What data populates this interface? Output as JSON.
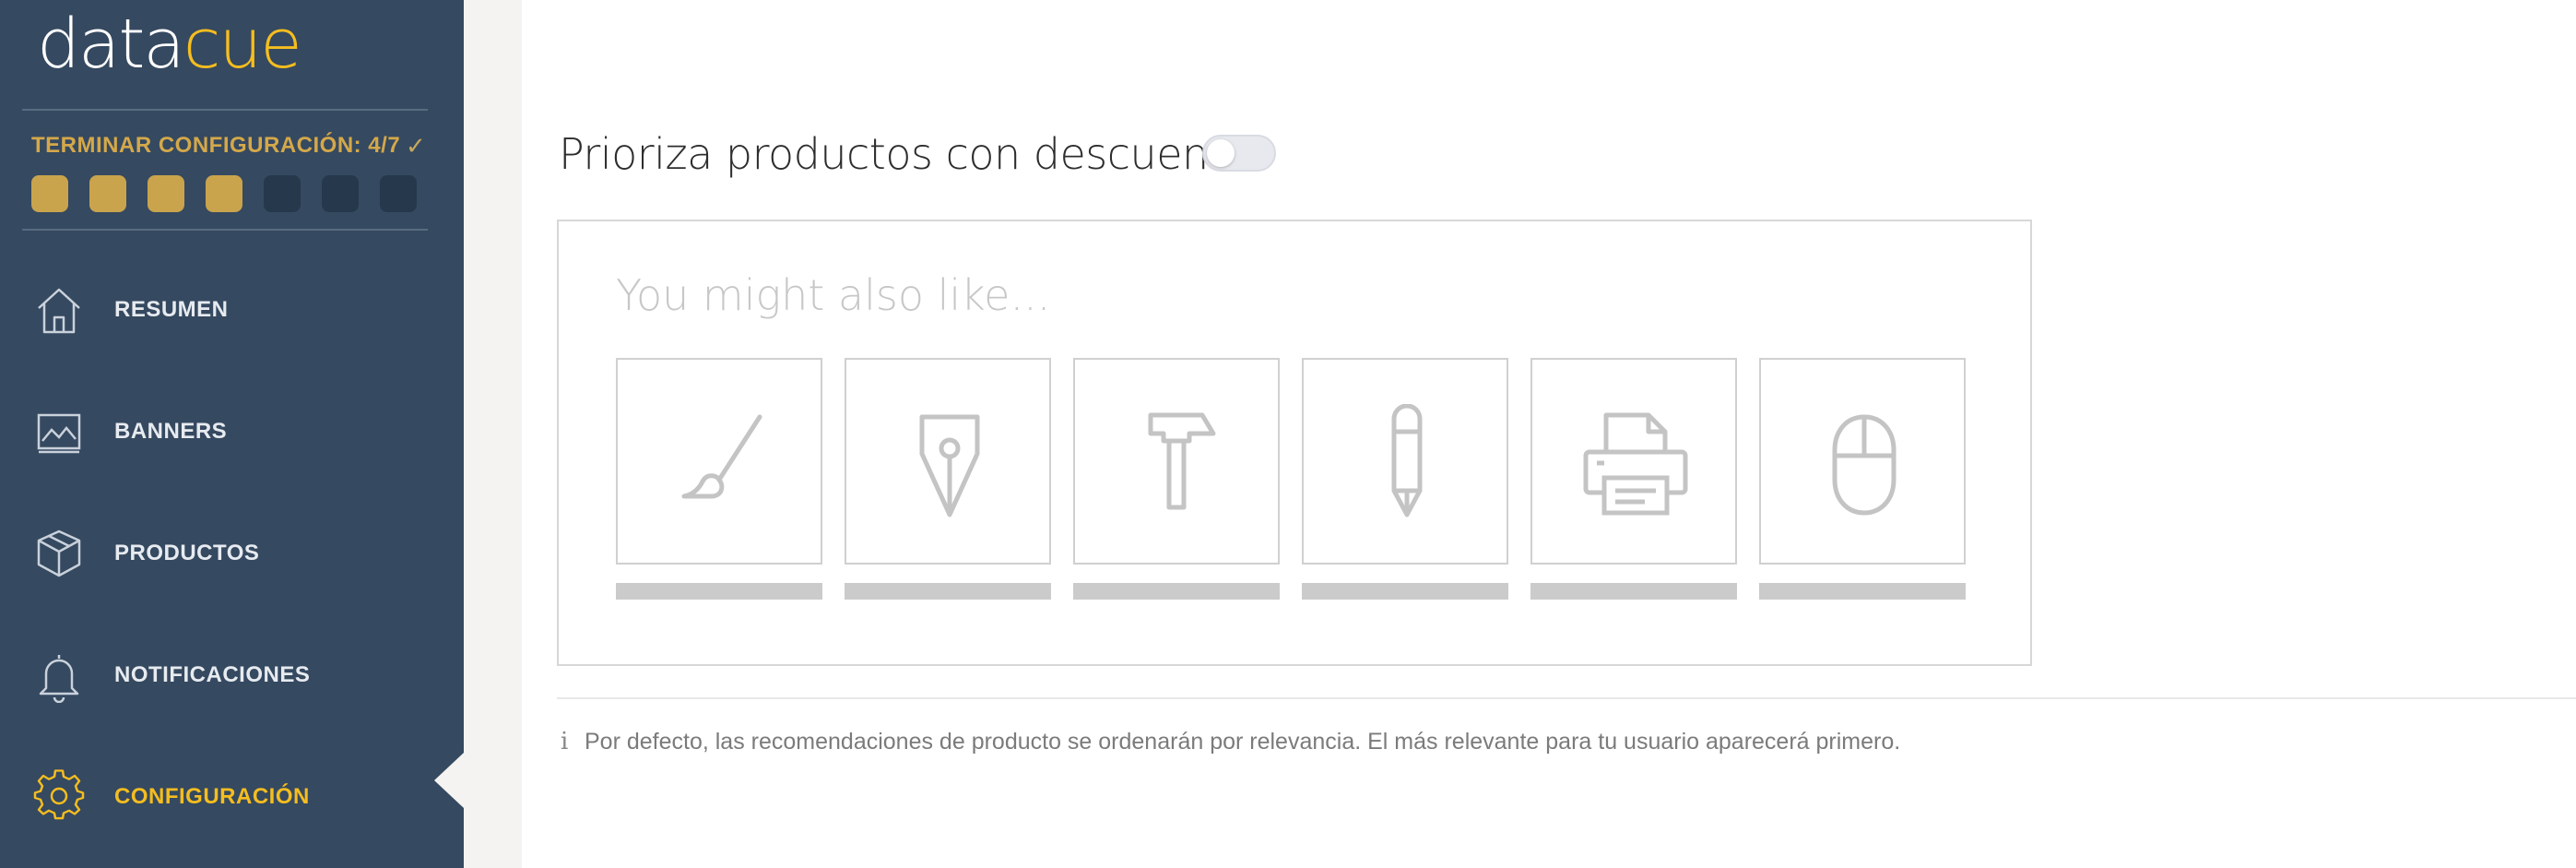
{
  "brand": {
    "logo_part1": "data",
    "logo_part2": "cue",
    "accent_color": "#f5bd1f"
  },
  "sidebar": {
    "progress": {
      "label": "TERMINAR CONFIGURACIÓN: 4/7",
      "completed_steps": 4,
      "total_steps": 7
    },
    "items": [
      {
        "label": "RESUMEN",
        "icon": "home-icon"
      },
      {
        "label": "BANNERS",
        "icon": "image-icon"
      },
      {
        "label": "PRODUCTOS",
        "icon": "box-icon"
      },
      {
        "label": "NOTIFICACIONES",
        "icon": "bell-icon"
      },
      {
        "label": "CONFIGURACIÓN",
        "icon": "gear-icon",
        "active": true
      }
    ]
  },
  "setting": {
    "title": "Prioriza productos con descuento",
    "toggle_on": false
  },
  "preview": {
    "title": "You might also like...",
    "products": [
      {
        "icon": "brush-icon"
      },
      {
        "icon": "pen-nib-icon"
      },
      {
        "icon": "hammer-icon"
      },
      {
        "icon": "pencil-icon"
      },
      {
        "icon": "printer-icon"
      },
      {
        "icon": "mouse-icon"
      }
    ]
  },
  "info": {
    "text": "Por defecto, las recomendaciones de producto se ordenarán por relevancia. El más relevante para tu usuario aparecerá primero."
  }
}
